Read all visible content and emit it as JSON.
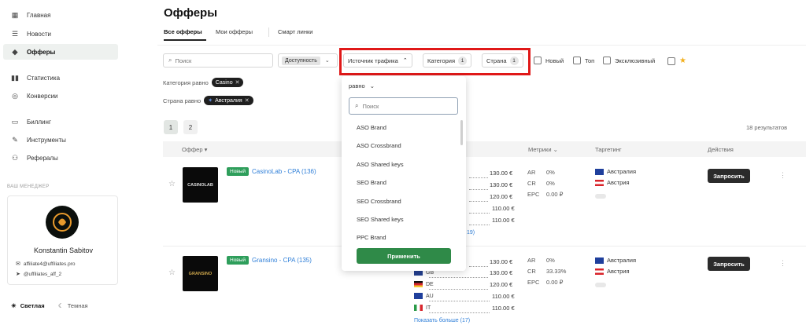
{
  "sidebar": {
    "items": [
      {
        "icon": "grid-icon",
        "label": "Главная"
      },
      {
        "icon": "list-icon",
        "label": "Новости"
      },
      {
        "icon": "tag-icon",
        "label": "Офферы"
      },
      {
        "icon": "bar-chart-icon",
        "label": "Статистика"
      },
      {
        "icon": "conversion-icon",
        "label": "Конверсии"
      },
      {
        "icon": "card-icon",
        "label": "Биллинг"
      },
      {
        "icon": "wrench-icon",
        "label": "Инструменты"
      },
      {
        "icon": "referral-icon",
        "label": "Рефералы"
      }
    ],
    "manager_title": "ВАШ МЕНЕДЖЕР",
    "manager": {
      "name": "Konstantin Sabitov",
      "email": "affiliate4@uffiliates.pro",
      "telegram": "@uffiliates_aff_2"
    },
    "theme_light": "Светлая",
    "theme_dark": "Темная"
  },
  "page": {
    "title": "Офферы",
    "tabs": [
      "Все офферы",
      "Мои офферы",
      "Смарт линки"
    ]
  },
  "filters": {
    "search_placeholder": "Поиск",
    "availability": "Доступность",
    "traffic_source": "Источник трафика",
    "category": "Категория",
    "category_count": "1",
    "country": "Страна",
    "country_count": "1",
    "checkboxes": [
      "Новый",
      "Топ",
      "Эксклюзивный"
    ],
    "category_row_label": "Категория равно",
    "category_value": "Casino",
    "country_row_label": "Страна равно",
    "country_value": "Австралия"
  },
  "pagination": {
    "pages": [
      "1",
      "2"
    ],
    "results": "18 результатов"
  },
  "table": {
    "headers": {
      "offer": "Оффер",
      "metrics": "Метрики",
      "targeting": "Таргетинг",
      "actions": "Действия"
    },
    "rows": [
      {
        "badge": "Новый",
        "name": "CasinoLab - CPA (136)",
        "logo": "CASINOLAB",
        "payouts": [
          "130.00 €",
          "130.00 €",
          "120.00 €",
          "110.00 €",
          "110.00 €"
        ],
        "geos": [],
        "more": "19)",
        "metrics": {
          "ar_label": "AR",
          "ar": "0%",
          "cr_label": "CR",
          "cr": "0%",
          "epc_label": "EPC",
          "epc": "0.00 ₽"
        },
        "targeting": [
          "Австралия",
          "Австрия"
        ],
        "action": "Запросить"
      },
      {
        "badge": "Новый",
        "name": "Gransino - CPA (135)",
        "logo": "GRANSINO",
        "payouts": [
          "130.00 €",
          "130.00 €",
          "120.00 €",
          "110.00 €",
          "110.00 €"
        ],
        "geos": [
          "GB",
          "DE",
          "AU",
          "IT"
        ],
        "more": "Показать больше (17)",
        "metrics": {
          "ar_label": "AR",
          "ar": "0%",
          "cr_label": "CR",
          "cr": "33.33%",
          "epc_label": "EPC",
          "epc": "0.00 ₽"
        },
        "targeting": [
          "Австралия",
          "Австрия"
        ],
        "action": "Запросить"
      }
    ]
  },
  "dropdown": {
    "operator": "равно",
    "search_placeholder": "Поиск",
    "options": [
      "ASO Brand",
      "ASO Crossbrand",
      "ASO Shared keys",
      "SEO Brand",
      "SEO Crossbrand",
      "SEO Shared keys",
      "PPC Brand"
    ],
    "apply": "Применить"
  },
  "colors": {
    "accent_green": "#2f8a48",
    "highlight_red": "#e01818",
    "link_blue": "#2f7fd8"
  }
}
